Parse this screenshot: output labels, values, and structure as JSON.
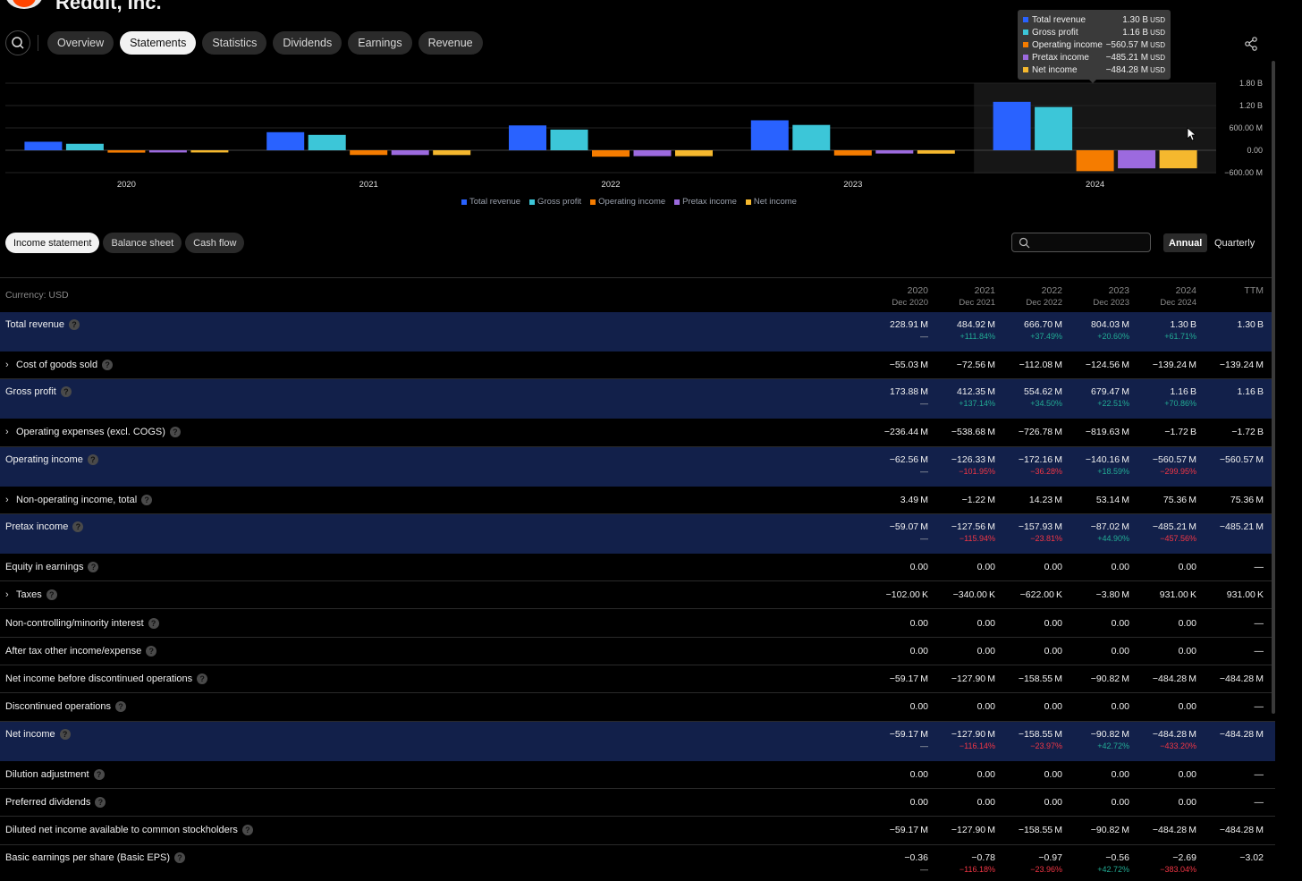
{
  "header": {
    "company": "Reddit, Inc."
  },
  "nav": {
    "tabs": [
      "Overview",
      "Statements",
      "Statistics",
      "Dividends",
      "Earnings",
      "Revenue"
    ],
    "active": "Statements"
  },
  "chart_data": {
    "type": "bar",
    "categories": [
      "2020",
      "2021",
      "2022",
      "2023",
      "2024"
    ],
    "series": [
      {
        "name": "Total revenue",
        "color": "#2962ff",
        "values": [
          228.91,
          484.92,
          666.7,
          804.03,
          1300
        ]
      },
      {
        "name": "Gross profit",
        "color": "#3cc6d8",
        "values": [
          173.88,
          412.35,
          554.62,
          679.47,
          1160
        ]
      },
      {
        "name": "Operating income",
        "color": "#f57c00",
        "values": [
          -62.56,
          -126.33,
          -172.16,
          -140.16,
          -560.57
        ]
      },
      {
        "name": "Pretax income",
        "color": "#9c6ade",
        "values": [
          -59.07,
          -127.56,
          -157.93,
          -87.02,
          -485.21
        ]
      },
      {
        "name": "Net income",
        "color": "#f5b82e",
        "values": [
          -59.17,
          -127.9,
          -158.55,
          -90.82,
          -484.28
        ]
      }
    ],
    "units": "M USD",
    "y_ticks": [
      "1.80 B",
      "1.20 B",
      "600.00 M",
      "0.00",
      "−600.00 M"
    ],
    "y_tick_values": [
      1800,
      1200,
      600,
      0,
      -600
    ],
    "ylim": [
      -600,
      1800
    ],
    "highlighted_category": "2024",
    "legend_position": "bottom",
    "grid": true
  },
  "tooltip": {
    "rows": [
      {
        "name": "Total revenue",
        "value": "1.30 B",
        "currency": "USD",
        "color": "#2962ff"
      },
      {
        "name": "Gross profit",
        "value": "1.16 B",
        "currency": "USD",
        "color": "#3cc6d8"
      },
      {
        "name": "Operating income",
        "value": "−560.57 M",
        "currency": "USD",
        "color": "#f57c00"
      },
      {
        "name": "Pretax income",
        "value": "−485.21 M",
        "currency": "USD",
        "color": "#9c6ade"
      },
      {
        "name": "Net income",
        "value": "−484.28 M",
        "currency": "USD",
        "color": "#f5b82e"
      }
    ]
  },
  "statement_tabs": [
    "Income statement",
    "Balance sheet",
    "Cash flow"
  ],
  "statement_active": "Income statement",
  "search": {
    "placeholder": ""
  },
  "period": {
    "annual": "Annual",
    "quarterly": "Quarterly"
  },
  "table": {
    "currency_label": "Currency: USD",
    "columns": [
      {
        "year": "2020",
        "date": "Dec 2020"
      },
      {
        "year": "2021",
        "date": "Dec 2021"
      },
      {
        "year": "2022",
        "date": "Dec 2022"
      },
      {
        "year": "2023",
        "date": "Dec 2023"
      },
      {
        "year": "2024",
        "date": "Dec 2024"
      },
      {
        "year": "TTM",
        "date": ""
      }
    ],
    "rows": [
      {
        "label": "Total revenue",
        "highlight": true,
        "expandable": false,
        "values": [
          "228.91 M",
          "484.92 M",
          "666.70 M",
          "804.03 M",
          "1.30 B",
          "1.30 B"
        ],
        "changes": [
          [
            "—",
            "dash"
          ],
          [
            "+111.84%",
            "pos"
          ],
          [
            "+37.49%",
            "pos"
          ],
          [
            "+20.60%",
            "pos"
          ],
          [
            "+61.71%",
            "pos"
          ],
          [
            "",
            ""
          ]
        ]
      },
      {
        "label": "Cost of goods sold",
        "highlight": false,
        "expandable": true,
        "values": [
          "−55.03 M",
          "−72.56 M",
          "−112.08 M",
          "−124.56 M",
          "−139.24 M",
          "−139.24 M"
        ]
      },
      {
        "label": "Gross profit",
        "highlight": true,
        "expandable": false,
        "values": [
          "173.88 M",
          "412.35 M",
          "554.62 M",
          "679.47 M",
          "1.16 B",
          "1.16 B"
        ],
        "changes": [
          [
            "—",
            "dash"
          ],
          [
            "+137.14%",
            "pos"
          ],
          [
            "+34.50%",
            "pos"
          ],
          [
            "+22.51%",
            "pos"
          ],
          [
            "+70.86%",
            "pos"
          ],
          [
            "",
            ""
          ]
        ]
      },
      {
        "label": "Operating expenses (excl. COGS)",
        "highlight": false,
        "expandable": true,
        "values": [
          "−236.44 M",
          "−538.68 M",
          "−726.78 M",
          "−819.63 M",
          "−1.72 B",
          "−1.72 B"
        ]
      },
      {
        "label": "Operating income",
        "highlight": true,
        "expandable": false,
        "values": [
          "−62.56 M",
          "−126.33 M",
          "−172.16 M",
          "−140.16 M",
          "−560.57 M",
          "−560.57 M"
        ],
        "changes": [
          [
            "—",
            "dash"
          ],
          [
            "−101.95%",
            "neg"
          ],
          [
            "−36.28%",
            "neg"
          ],
          [
            "+18.59%",
            "pos"
          ],
          [
            "−299.95%",
            "neg"
          ],
          [
            "",
            ""
          ]
        ]
      },
      {
        "label": "Non-operating income, total",
        "highlight": false,
        "expandable": true,
        "values": [
          "3.49 M",
          "−1.22 M",
          "14.23 M",
          "53.14 M",
          "75.36 M",
          "75.36 M"
        ]
      },
      {
        "label": "Pretax income",
        "highlight": true,
        "expandable": false,
        "values": [
          "−59.07 M",
          "−127.56 M",
          "−157.93 M",
          "−87.02 M",
          "−485.21 M",
          "−485.21 M"
        ],
        "changes": [
          [
            "—",
            "dash"
          ],
          [
            "−115.94%",
            "neg"
          ],
          [
            "−23.81%",
            "neg"
          ],
          [
            "+44.90%",
            "pos"
          ],
          [
            "−457.56%",
            "neg"
          ],
          [
            "",
            ""
          ]
        ]
      },
      {
        "label": "Equity in earnings",
        "highlight": false,
        "expandable": false,
        "values": [
          "0.00",
          "0.00",
          "0.00",
          "0.00",
          "0.00",
          "—"
        ]
      },
      {
        "label": "Taxes",
        "highlight": false,
        "expandable": true,
        "values": [
          "−102.00 K",
          "−340.00 K",
          "−622.00 K",
          "−3.80 M",
          "931.00 K",
          "931.00 K"
        ]
      },
      {
        "label": "Non-controlling/minority interest",
        "highlight": false,
        "expandable": false,
        "values": [
          "0.00",
          "0.00",
          "0.00",
          "0.00",
          "0.00",
          "—"
        ]
      },
      {
        "label": "After tax other income/expense",
        "highlight": false,
        "expandable": false,
        "values": [
          "0.00",
          "0.00",
          "0.00",
          "0.00",
          "0.00",
          "—"
        ]
      },
      {
        "label": "Net income before discontinued operations",
        "highlight": false,
        "expandable": false,
        "values": [
          "−59.17 M",
          "−127.90 M",
          "−158.55 M",
          "−90.82 M",
          "−484.28 M",
          "−484.28 M"
        ]
      },
      {
        "label": "Discontinued operations",
        "highlight": false,
        "expandable": false,
        "values": [
          "0.00",
          "0.00",
          "0.00",
          "0.00",
          "0.00",
          "—"
        ]
      },
      {
        "label": "Net income",
        "highlight": true,
        "expandable": false,
        "values": [
          "−59.17 M",
          "−127.90 M",
          "−158.55 M",
          "−90.82 M",
          "−484.28 M",
          "−484.28 M"
        ],
        "changes": [
          [
            "—",
            "dash"
          ],
          [
            "−116.14%",
            "neg"
          ],
          [
            "−23.97%",
            "neg"
          ],
          [
            "+42.72%",
            "pos"
          ],
          [
            "−433.20%",
            "neg"
          ],
          [
            "",
            ""
          ]
        ]
      },
      {
        "label": "Dilution adjustment",
        "highlight": false,
        "expandable": false,
        "values": [
          "0.00",
          "0.00",
          "0.00",
          "0.00",
          "0.00",
          "—"
        ]
      },
      {
        "label": "Preferred dividends",
        "highlight": false,
        "expandable": false,
        "values": [
          "0.00",
          "0.00",
          "0.00",
          "0.00",
          "0.00",
          "—"
        ]
      },
      {
        "label": "Diluted net income available to common stockholders",
        "highlight": false,
        "expandable": false,
        "values": [
          "−59.17 M",
          "−127.90 M",
          "−158.55 M",
          "−90.82 M",
          "−484.28 M",
          "−484.28 M"
        ]
      },
      {
        "label": "Basic earnings per share (Basic EPS)",
        "highlight": false,
        "expandable": false,
        "values": [
          "−0.36",
          "−0.78",
          "−0.97",
          "−0.56",
          "−2.69",
          "−3.02"
        ],
        "changes": [
          [
            "—",
            "dash"
          ],
          [
            "−116.18%",
            "neg"
          ],
          [
            "−23.96%",
            "neg"
          ],
          [
            "+42.72%",
            "pos"
          ],
          [
            "−383.04%",
            "neg"
          ],
          [
            "",
            ""
          ]
        ]
      }
    ]
  }
}
